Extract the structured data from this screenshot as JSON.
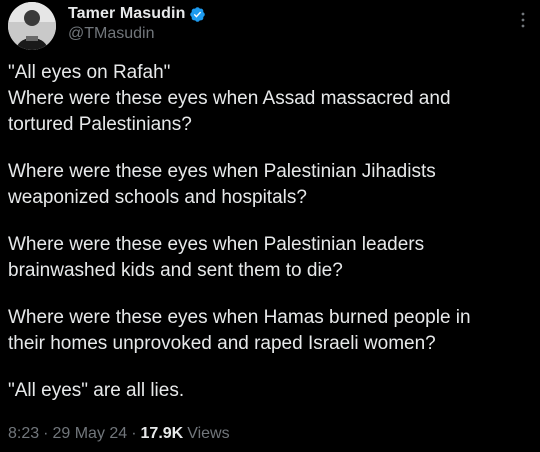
{
  "author": {
    "display_name": "Tamer Masudin",
    "handle": "@TMasudin",
    "verified": true
  },
  "tweet": {
    "paragraphs": [
      [
        "\"All eyes on Rafah\"",
        "Where were these eyes when Assad massacred and",
        "tortured Palestinians?"
      ],
      [
        "Where were these eyes when Palestinian Jihadists",
        "weaponized schools and hospitals?"
      ],
      [
        "Where were these eyes when Palestinian leaders",
        "brainwashed kids and sent them to die?"
      ],
      [
        "Where were these eyes when Hamas burned people in",
        "their homes unprovoked and raped Israeli women?"
      ],
      [
        "\"All eyes\" are all lies."
      ]
    ]
  },
  "meta": {
    "time": "8:23",
    "date": "29 May 24",
    "views_count": "17.9K",
    "views_label": "Views",
    "separator": "·"
  },
  "icons": {
    "verified": "verified-badge-icon",
    "more": "more-options-icon"
  },
  "colors": {
    "background": "#000000",
    "text": "#e7e9ea",
    "secondary": "#71767b",
    "verified": "#1d9bf0"
  }
}
